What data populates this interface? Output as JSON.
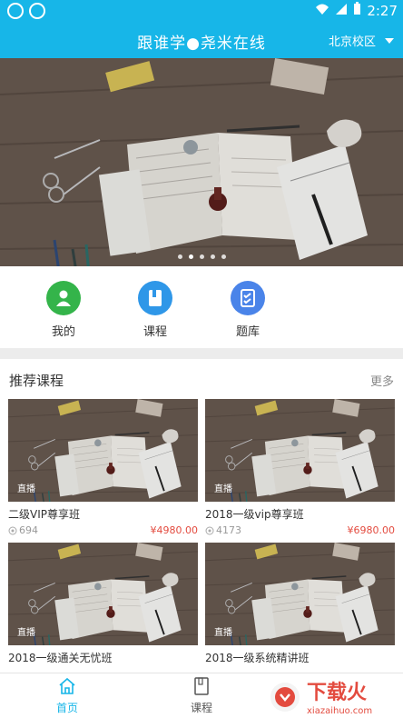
{
  "status_bar": {
    "time": "2:27"
  },
  "app_bar": {
    "title": "跟谁学●尧米在线",
    "campus": "北京校区"
  },
  "banner": {
    "slide_count": 5,
    "active_index": 1
  },
  "quick_menu": [
    {
      "label": "我的",
      "icon": "user-icon",
      "color": "#34b44a"
    },
    {
      "label": "课程",
      "icon": "book-icon",
      "color": "#2f97e8"
    },
    {
      "label": "题库",
      "icon": "question-bank-icon",
      "color": "#4a84e9"
    }
  ],
  "recommend": {
    "title": "推荐课程",
    "more": "更多",
    "courses": [
      {
        "tag": "直播",
        "name": "二级VIP尊享班",
        "views": "694",
        "price": "¥4980.00"
      },
      {
        "tag": "直播",
        "name": "2018一级vip尊享班",
        "views": "4173",
        "price": "¥6980.00"
      },
      {
        "tag": "直播",
        "name": "2018一级通关无忧班",
        "views": "",
        "price": ""
      },
      {
        "tag": "直播",
        "name": "2018一级系统精讲班",
        "views": "",
        "price": ""
      }
    ]
  },
  "bottom_nav": [
    {
      "label": "首页",
      "icon": "home-icon",
      "active": true
    },
    {
      "label": "课程",
      "icon": "course-book-icon",
      "active": false
    }
  ],
  "watermark": {
    "brand": "下载火",
    "domain": "xiazaihuo.com"
  },
  "colors": {
    "primary": "#17b6e8",
    "price": "#e34b3f"
  }
}
